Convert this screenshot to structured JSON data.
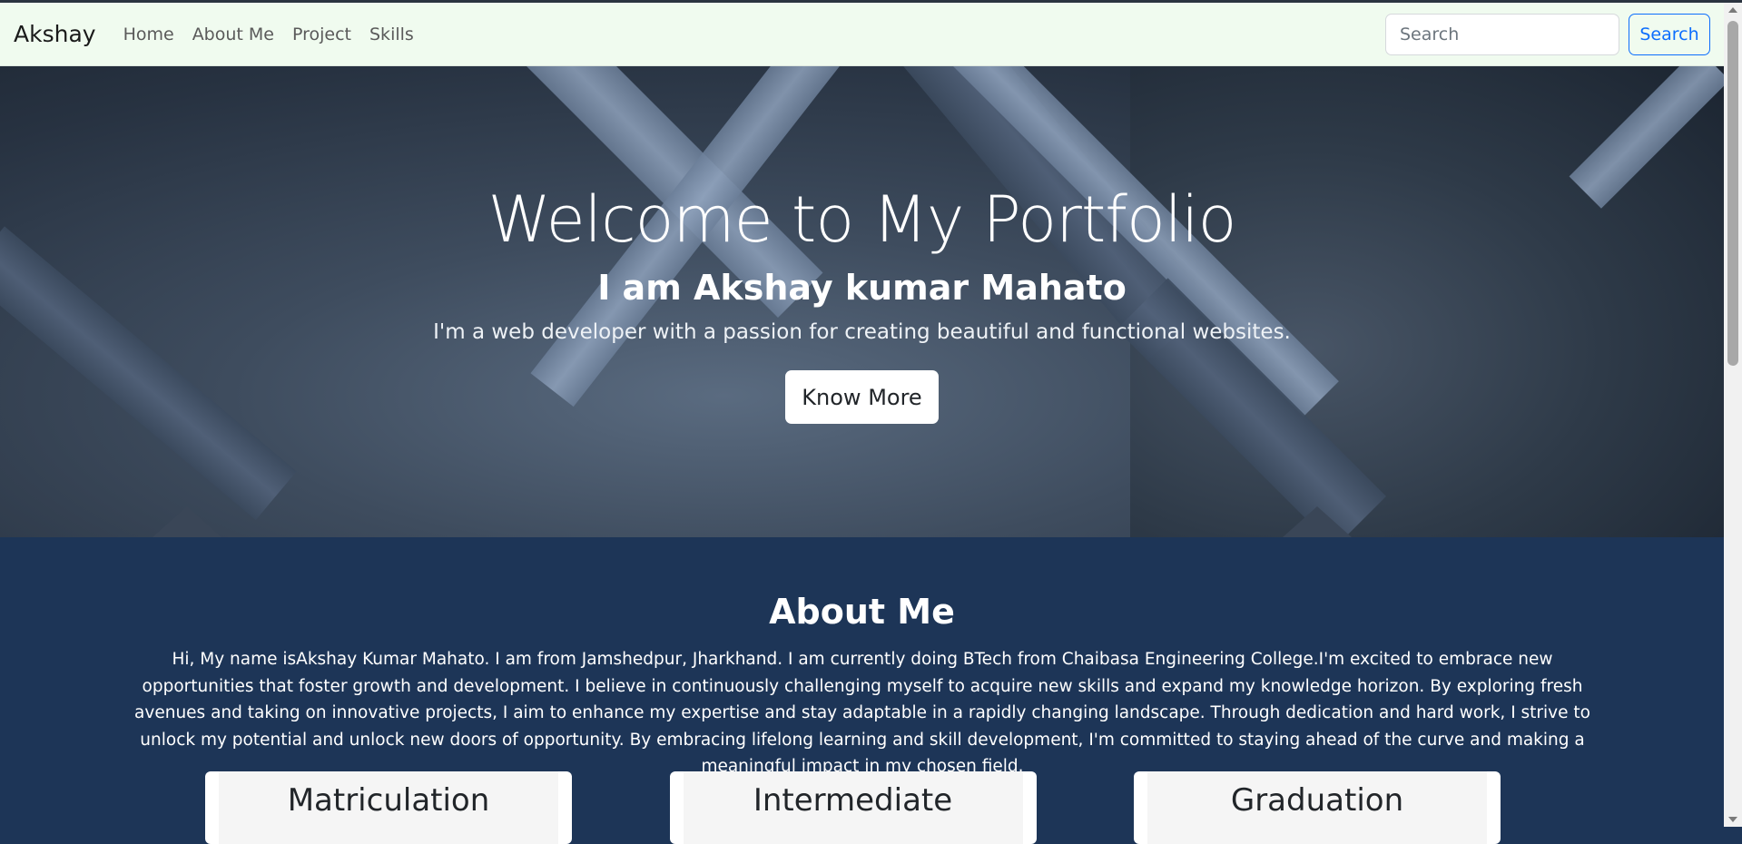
{
  "navbar": {
    "brand": "Akshay",
    "links": [
      "Home",
      "About Me",
      "Project",
      "Skills"
    ],
    "search_placeholder": "Search",
    "search_button": "Search"
  },
  "hero": {
    "title": "Welcome to My Portfolio",
    "subtitle": "I am Akshay kumar Mahato",
    "description": "I'm a web developer with a passion for creating beautiful and functional websites.",
    "button": "Know More"
  },
  "about": {
    "title": "About Me",
    "text": "Hi, My name isAkshay Kumar Mahato. I am from Jamshedpur, Jharkhand. I am currently doing BTech from Chaibasa Engineering College.I'm excited to embrace new opportunities that foster growth and development. I believe in continuously challenging myself to acquire new skills and expand my knowledge horizon. By exploring fresh avenues and taking on innovative projects, I aim to enhance my expertise and stay adaptable in a rapidly changing landscape. Through dedication and hard work, I strive to unlock my potential and unlock new doors of opportunity. By embracing lifelong learning and skill development, I'm committed to staying ahead of the curve and making a meaningful impact in my chosen field.",
    "cards": [
      "Matriculation",
      "Intermediate",
      "Graduation"
    ]
  },
  "colors": {
    "navbar_bg": "#f0fbef",
    "about_bg": "#1d3557",
    "search_accent": "#0d6efd"
  }
}
